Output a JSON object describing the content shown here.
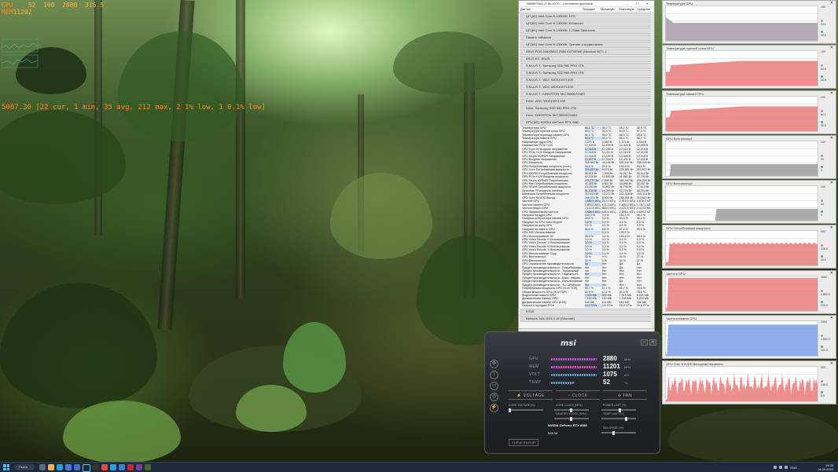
{
  "osd": {
    "gpu_label": "GPU",
    "gpu_temp": "52",
    "gpu_load": "100",
    "gpu_clock": "2880",
    "gpu_power": "315.5",
    "mem_label": "MEM",
    "mem_clock": "11202",
    "fps_line": "5007.30 [22 cur, 1 min, 35 avg, 212 max, 2 1% low, 1 0.1% low]"
  },
  "sensors": {
    "title": "HWiNFO64 v7.60-5170 – Состояние датчиков",
    "columns": [
      "Датчик",
      "Текущее",
      "Минимум",
      "Максимум",
      "Среднее"
    ],
    "groups_top": [
      "ЦП [#0]: Intel Core i9-13900K: DTS",
      "ЦП [#0]: Intel Core i9-13900K: Enhanced",
      "ЦП [#0]: Intel Core i9-13900K: C-State Занятость",
      "Память тайминги",
      "ЦП [#0]: Intel Core i9-13900K: Тренинг и ограничения",
      "ASUS ROG MAXIMUS Z690 EXTREME (Nuvoton NCT...)",
      "ASUS EC: ASUS",
      "S.M.A.R.T.: Samsung SSD 980 PRO 2TB",
      "S.M.A.R.T.: Samsung SSD 980 PRO 2TB",
      "S.M.A.R.T.: WDC WDS100T1X0E",
      "S.M.A.R.T.: WDC WDS100T1X0E",
      "S.M.A.R.T.: KINGSTON SKC3000D2048G",
      "Drive: WDC WDS100T1X0E",
      "Drive: Samsung SSD 980 PRO 2TB",
      "Drive: KINGSTON SKC3000D2048G"
    ],
    "gpu_group": "GPU [#0]: NVIDIA GeForce RTX 4080",
    "gpu_rows": [
      [
        "Температура GPU",
        "54,1 °C",
        "30,0 °C",
        "55,2 °C",
        "48,9 °C"
      ],
      [
        "Температура горячей точки GPU",
        "64,0 °C",
        "34,5 °C",
        "64,5 °C",
        "57,4 °C"
      ],
      [
        "Температура перехода памяти GPU",
        "64,1 °C",
        "36,0 °C",
        "66,0 °C",
        "59,5 °C"
      ],
      [
        "Температура памяти GPU",
        "64,0 °C",
        "38,0 °C",
        "66,0 °C",
        "58,7 °C"
      ],
      [
        "Напряжение ядра GPU",
        "1,070 В",
        "0,940 В",
        "1,070 В",
        "1,050 В"
      ],
      [
        "Напряжение PCIe +12V",
        "12,409 В",
        "12,299 В",
        "12,423 В",
        "12,408 В"
      ],
      [
        "GPU 8-pin #1 Входное напряжение",
        "12,318 В",
        "12,288 В",
        "12,413 В",
        "12,318 В"
      ],
      [
        "GPU PCIe +12V Входное напряжение",
        "12,318 В",
        "12,211 В",
        "12,323 В",
        "12,313 В"
      ],
      [
        "GPU 16-pin HVPWR Напряжение",
        "12,318 В",
        "12,199 В",
        "12,408 В",
        "12,318 В"
      ],
      [
        "GPU Входное напряжение",
        "12,417 В",
        "12,318 В",
        "12,431 В",
        "12,416 В"
      ],
      [
        "GPU Мощность",
        "318,963 Вт",
        "44,146 Вт",
        "320,167 Вт",
        "286,226 Вт"
      ],
      [
        "GPU Потребляемая мощность (norm)",
        "98,6 %",
        "22,2 %",
        "100,0 %",
        "89,2 %"
      ],
      [
        "GPU Core Потребляемая мощность",
        "224,622 Вт",
        "9,675 Вт",
        "226,981 Вт",
        "203,622 Вт"
      ],
      [
        "GPU FBVDD Потребляемая мощность",
        "38,918 Вт",
        "7,308 Вт",
        "40,217 Вт",
        "35,512 Вт"
      ],
      [
        "GPU PCIe +12V Входная мощность",
        "40,228 Вт",
        "12,800 Вт",
        "41,982 Вт",
        "37,733 Вт"
      ],
      [
        "GPU 16-pin HVPWR Потребляемая",
        "275,737 Вт",
        "7,896 Вт",
        "281,187 Вт",
        "255,259 Вт"
      ],
      [
        "GPU Rail Потребляемая мощность",
        "40,359 Вт",
        "6,907 Вт",
        "44,896 Вт",
        "36,407 Вт"
      ],
      [
        "GPU SRAM Потребляемая мощность",
        "40,230 Вт",
        "10,802 Вт",
        "41,796 Вт",
        "37,512 Вт"
      ],
      [
        "Источник PP входного питания",
        "81,704 Вт",
        "14,393 Вт",
        "42,704 Вт",
        "38,204 Вт"
      ],
      [
        "Mainboard Потребляемая мощность",
        "212,615 Вт",
        "12,072 Вт",
        "292,328 Вт",
        "193,314 Вт"
      ],
      [
        "GPU Core NVVDD Выход",
        "246,015 Вт",
        "8,000 Вт",
        "248,981 Вт",
        "223,623 Вт"
      ],
      [
        "Частота GPU",
        "2.880,0 МГц",
        "210,0 МГц",
        "2.910,0 МГц",
        "2.878,2 МГц"
      ],
      [
        "Частота памяти GPU",
        "1.800,0 МГц",
        "101,3 МГц",
        "1.800,0 МГц",
        "1.787,1 МГц"
      ],
      [
        "Частота видео GPU",
        "2.122,5 МГц",
        "855,0 МГц",
        "2.122,5 МГц",
        "2.110,6 МГц"
      ],
      [
        "GPU Эффективная частота",
        "2.868,9 МГц",
        "181,4 МГц",
        "2.898,1 МГц",
        "2.839,2 МГц"
      ],
      [
        "Нагрузка на ядро GPU",
        "100,0 %",
        "0,0 %",
        "100,0 %",
        "96,2 %"
      ],
      [
        "Нагрузка контроллера памяти GPU",
        "38,0 %",
        "0,0 %",
        "40,0 %",
        "35,4 %"
      ],
      [
        "Нагрузка на GPU Video Engine",
        "0,0 %",
        "0,0 %",
        "0,0 %",
        "0,0 %"
      ],
      [
        "Нагрузка на шину GPU",
        "2,0 %",
        "0,0 %",
        "6,0 %",
        "2,3 %"
      ],
      [
        "Нагрузка на память GPU",
        "46,6 %",
        "8,8 %",
        "47,2 %",
        "45,5 %"
      ],
      [
        "GPU D3D Использование",
        "",
        "0,0 %",
        "100,0 %",
        ""
      ],
      [
        "GPU Использование 3D",
        "98,6 %",
        "0,0 %",
        "100,0 %",
        "95,3 %"
      ],
      [
        "GPU Video Decode 0 Использование",
        "0,0 %",
        "0,0 %",
        "0,0 %",
        "0,0 %"
      ],
      [
        "GPU Video Decode 1 Использование",
        "0,0 %",
        "0,0 %",
        "0,0 %",
        "0,0 %"
      ],
      [
        "GPU Video Encode 0 Использование",
        "0,0 %",
        "0,0 %",
        "0,0 %",
        "0,0 %"
      ],
      [
        "GPU Video Encode 1 Использование",
        "0,0 %",
        "0,0 %",
        "0,0 %",
        "0,0 %"
      ],
      [
        "GPU Использование Copy",
        "0,0 %",
        "0,0 %",
        "0,0 %",
        "0,0 %"
      ],
      [
        "GPU Вентилятор1",
        "34 %",
        "0 %",
        "34 %",
        "27 %"
      ],
      [
        "GPU Вентилятор2",
        "34 %",
        "0 %",
        "34 %",
        "27 %"
      ],
      [
        "GPU Ограничение производительности",
        "Да",
        "Нет",
        "Да",
        "Да"
      ],
      [
        "Предел производительности - Потребляемая",
        "Нет",
        "Нет",
        "Да",
        "Нет"
      ],
      [
        "Предел производительности - Термальный",
        "Нет",
        "Нет",
        "Нет",
        "Нет"
      ],
      [
        "Предел производительности - Надёжность",
        "Нет",
        "Нет",
        "Нет",
        "Нет"
      ],
      [
        "Предел производительности - Макс. напряж.",
        "Нет",
        "Нет",
        "Нет",
        "Нет"
      ],
      [
        "Предел производительности - Использование",
        "Нет",
        "Нет",
        "Да",
        "Нет"
      ],
      [
        "Предел производительности - SLI GPUBoost",
        "Нет",
        "Нет",
        "Нет",
        "Нет"
      ],
      [
        "Потребляемая мощность GPU (% от TDP)",
        "85,7 %",
        "12,7 %",
        "85,7 %",
        "78,8 %"
      ],
      [
        "Общая мощность GPU (% of TDP)",
        "82,9 %",
        "12,1 %",
        "87,2 %",
        "78,6 %"
      ],
      [
        "Выделенная память GPU",
        "7,223 МБ",
        "809 МБ",
        "7,315 МБ",
        "6,231 МБ"
      ],
      [
        "Динамическая память GPU",
        "7,100 МБ",
        "152 МБ",
        "7,245 МБ",
        "6,215 МБ"
      ],
      [
        "Динамическая память GPU (D3D)",
        "164 МБ",
        "113 МБ",
        "163 МБ",
        "158 МБ"
      ],
      [
        "Скорость передачи PCIe",
        "16,0 GT/s",
        "2,5 GT/s",
        "16,0 GT/s",
        "15,8 GT/s"
      ]
    ],
    "groups_bottom": [
      "RTSS",
      "Network: Intel I225-V #2 (Ethernet)"
    ]
  },
  "graphs": [
    {
      "title": "Температура GPU",
      "color": "#a69aaa",
      "max": "100",
      "cur": "54,1",
      "min": "30,0",
      "shape": "plateau"
    },
    {
      "title": "Температура горячей точки GPU",
      "color": "#e87b7b",
      "max": "100",
      "cur": "64,0",
      "min": "34,5",
      "shape": "rise"
    },
    {
      "title": "Температура памяти GPU",
      "color": "#e87b7b",
      "max": "100",
      "cur": "64,1",
      "min": "36,0",
      "shape": "rise"
    },
    {
      "title": "GPU Вентилятор1",
      "color": "#9c9c9c",
      "max": "100",
      "cur": "34",
      "min": "0",
      "shape": "step"
    },
    {
      "title": "GPU Вентилятор2",
      "color": "#9c9c9c",
      "max": "100",
      "cur": "34",
      "min": "0",
      "shape": "stepLate"
    },
    {
      "title": "GPU Потребляемая мощность",
      "color": "#e87b7b",
      "max": "500",
      "cur": "318,9",
      "min": "44,1",
      "shape": "high"
    },
    {
      "title": "Частота GPU",
      "color": "#e87b7b",
      "max": "3000",
      "cur": "2.880,0",
      "min": "210,0",
      "shape": "full"
    },
    {
      "title": "Частота памяти GPU",
      "color": "#7aa0e8",
      "max": "2000",
      "cur": "1.800,0",
      "min": "101,3",
      "shape": "fullBlue"
    },
    {
      "title": "GPU Core NVVDD Выходная мощность",
      "color": "#e87b7b",
      "max": "500",
      "cur": "246,0",
      "min": "8,0",
      "shape": "spiky"
    }
  ],
  "afterburner": {
    "logo": "msi",
    "gpu_label": "GPU",
    "gpu_value": "2880",
    "gpu_unit": "MHz",
    "mem_label": "MEM",
    "mem_value": "11201",
    "mem_unit": "MHz",
    "volt_label": "VOLT",
    "volt_value": "1075",
    "volt_unit": "mV",
    "temp_label": "TEMP",
    "temp_value": "52",
    "temp_unit": "°C",
    "tab_voltage": "VOLTAGE",
    "tab_clock": "CLOCK",
    "tab_fan": "FAN",
    "core_voltage_label": "CORE VOLTAGE (%)",
    "core_clock_label": "CORE CLOCK (MHz)",
    "memory_clock_label": "MEMORY CLOCK (MHz)",
    "power_limit_label": "POWER LIMIT (%)",
    "temp_limit_label": "TEMP. LIMIT (°C)",
    "fan_speed_label": "FAN SPEED (%)",
    "card_name": "NVIDIA GeForce RTX 4080",
    "driver_version": "528.49",
    "curve_editor": "CURVE EDITOR"
  },
  "taskbar": {
    "search_label": "Поиск",
    "time": "14:23",
    "date": "14.09.2023",
    "lang": "ENG"
  }
}
